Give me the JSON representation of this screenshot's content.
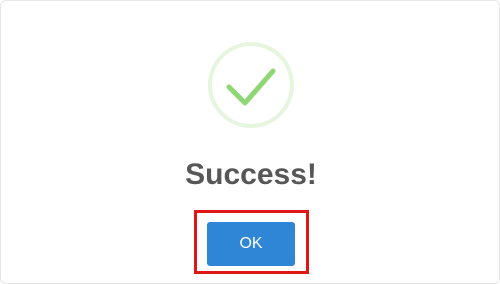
{
  "dialog": {
    "title": "Success!",
    "icon": "checkmark-icon",
    "ok_label": "OK"
  },
  "colors": {
    "icon_ring": "#e6f5dd",
    "icon_check": "#8fd674",
    "ok_button": "#2f86d6",
    "highlight": "#e01717",
    "title_text": "#575757"
  }
}
